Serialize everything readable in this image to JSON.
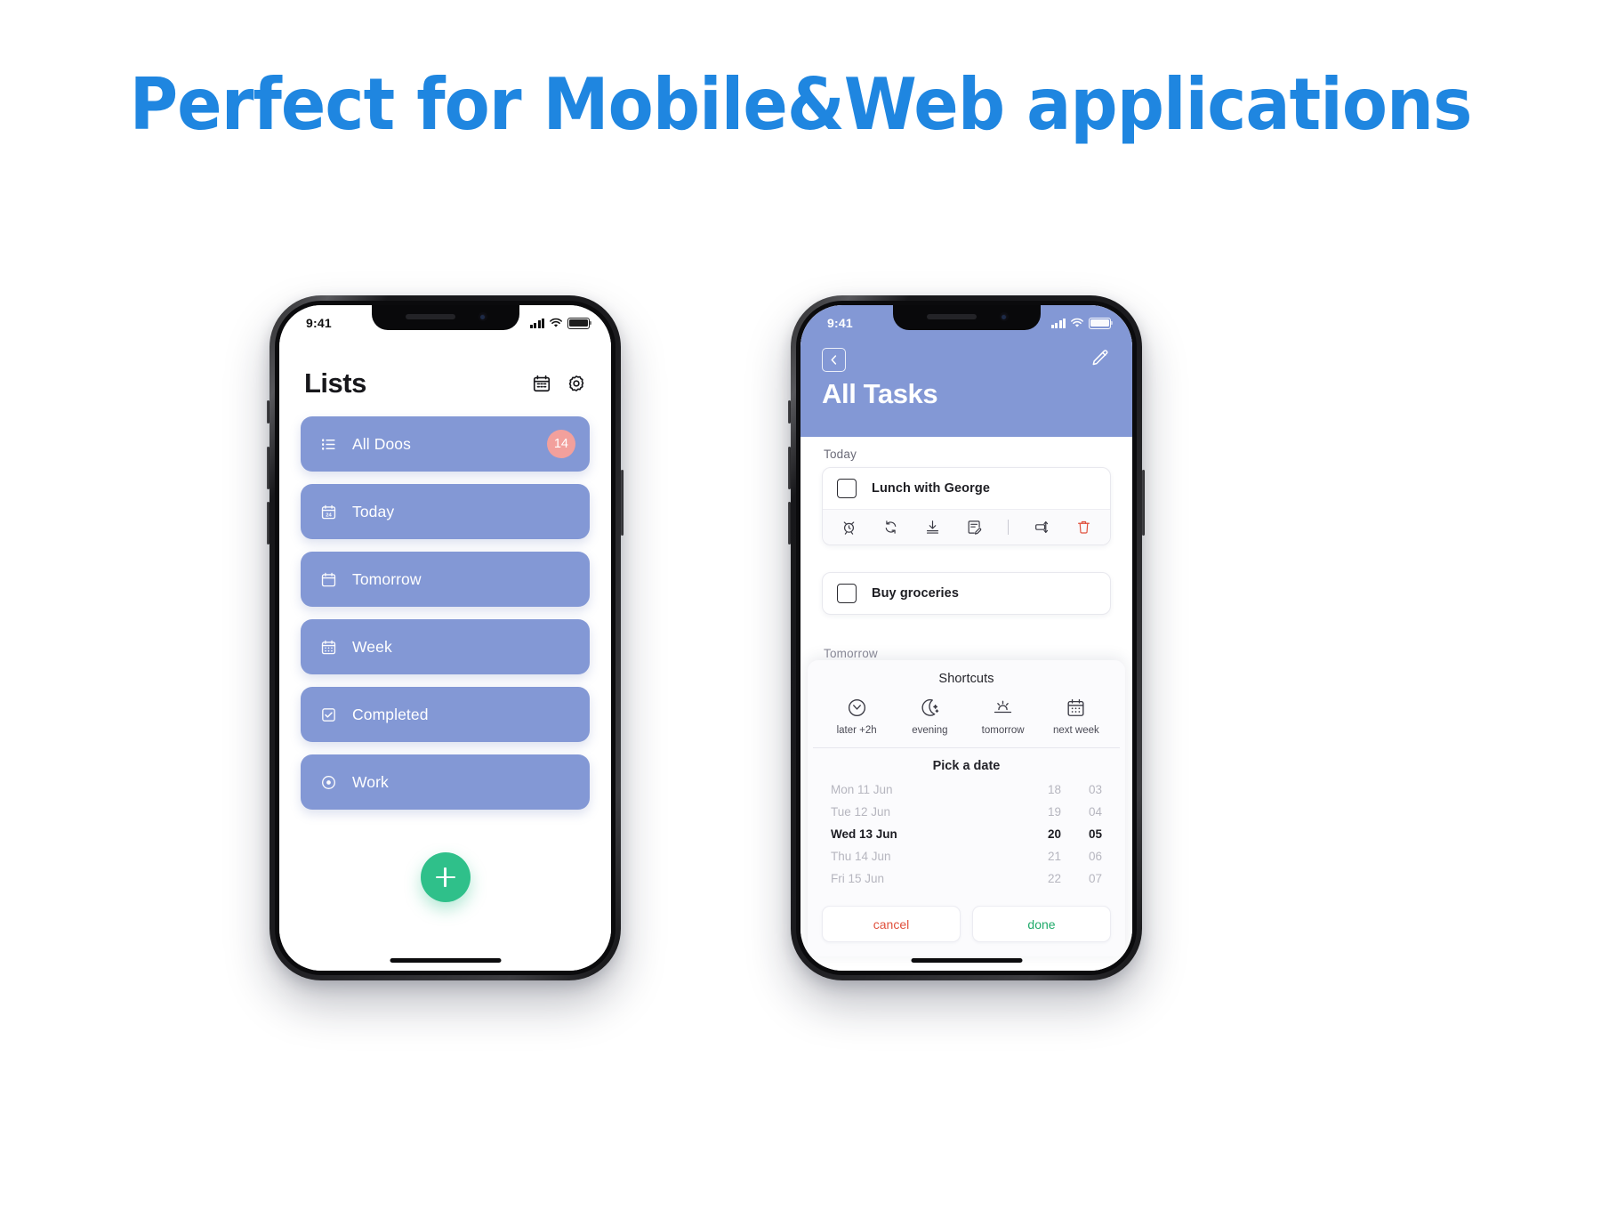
{
  "headline": "Perfect for Mobile&Web applications",
  "theme": {
    "accent_blue": "#1f86e0",
    "card_blue": "#8398d5",
    "badge_pink": "#f2a09c",
    "fab_green": "#2fc08a",
    "cancel_red": "#e0503c",
    "done_green": "#1faa6a",
    "trash_red": "#e0503c"
  },
  "phone_left": {
    "statusbar": {
      "time": "9:41",
      "signal_icon": "cellular-bars-icon",
      "wifi_icon": "wifi-icon",
      "battery_icon": "battery-icon"
    },
    "title": "Lists",
    "header_actions": [
      {
        "name": "calendar-icon",
        "label": "calendar-icon"
      },
      {
        "name": "gear-icon",
        "label": "gear-icon"
      }
    ],
    "items": [
      {
        "label": "All Doos",
        "icon": "list-icon",
        "badge": "14"
      },
      {
        "label": "Today",
        "icon": "calendar-24-icon",
        "badge": ""
      },
      {
        "label": "Tomorrow",
        "icon": "calendar-blank-icon",
        "badge": ""
      },
      {
        "label": "Week",
        "icon": "calendar-grid-icon",
        "badge": ""
      },
      {
        "label": "Completed",
        "icon": "checkbox-check-icon",
        "badge": ""
      },
      {
        "label": "Work",
        "icon": "radio-dot-icon",
        "badge": ""
      }
    ],
    "fab": {
      "icon": "plus-icon",
      "label": "+"
    }
  },
  "phone_right": {
    "statusbar": {
      "time": "9:41",
      "signal_icon": "cellular-bars-icon",
      "wifi_icon": "wifi-icon",
      "battery_icon": "battery-icon"
    },
    "title": "All Tasks",
    "back_icon": "chevron-left-icon",
    "edit_icon": "pencil-icon",
    "sections": [
      {
        "label": "Today"
      },
      {
        "label": "Tomorrow"
      }
    ],
    "tasks": [
      {
        "text": "Lunch with George",
        "checked": false,
        "expanded": true
      },
      {
        "text": "Buy groceries",
        "checked": false,
        "expanded": false
      }
    ],
    "task_actions": [
      {
        "name": "alarm-icon"
      },
      {
        "name": "repeat-icon"
      },
      {
        "name": "download-icon"
      },
      {
        "name": "note-edit-icon"
      },
      {
        "name": "divider"
      },
      {
        "name": "move-icon"
      },
      {
        "name": "trash-icon"
      }
    ],
    "sheet": {
      "title": "Shortcuts",
      "shortcuts": [
        {
          "label": "later +2h",
          "icon": "clock-chevron-icon"
        },
        {
          "label": "evening",
          "icon": "moon-stars-icon"
        },
        {
          "label": "tomorrow",
          "icon": "sunrise-icon"
        },
        {
          "label": "next week",
          "icon": "calendar-week-icon"
        }
      ],
      "pick_title": "Pick a date",
      "picker_rows": [
        {
          "day": "Mon 11 Jun",
          "hour": "18",
          "minute": "03",
          "selected": false
        },
        {
          "day": "Tue 12 Jun",
          "hour": "19",
          "minute": "04",
          "selected": false
        },
        {
          "day": "Wed 13 Jun",
          "hour": "20",
          "minute": "05",
          "selected": true
        },
        {
          "day": "Thu 14 Jun",
          "hour": "21",
          "minute": "06",
          "selected": false
        },
        {
          "day": "Fri 15 Jun",
          "hour": "22",
          "minute": "07",
          "selected": false
        }
      ],
      "cancel_label": "cancel",
      "done_label": "done"
    }
  }
}
